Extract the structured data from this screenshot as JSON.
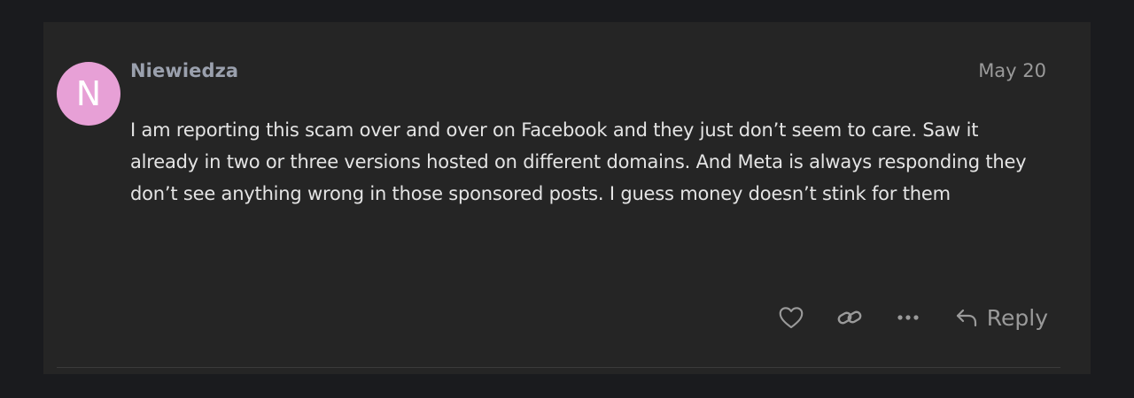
{
  "post": {
    "avatar_letter": "N",
    "avatar_color": "#e7a0d6",
    "username": "Niewiedza",
    "date": "May 20",
    "body": "I am reporting this scam over and over on Facebook and they just don’t seem to care. Saw it already in two or three versions hosted on different domains. And Meta is always responding they don’t see anything wrong in those sponsored posts. I guess money doesn’t stink for them"
  },
  "actions": {
    "like_icon": "heart-icon",
    "link_icon": "link-icon",
    "more_icon": "ellipsis-icon",
    "reply_icon": "reply-arrow-icon",
    "reply_label": "Reply"
  },
  "colors": {
    "page_background": "#1a1b1e",
    "post_background": "#252525",
    "text": "#e4e4e4",
    "muted": "#9a9a9a"
  }
}
